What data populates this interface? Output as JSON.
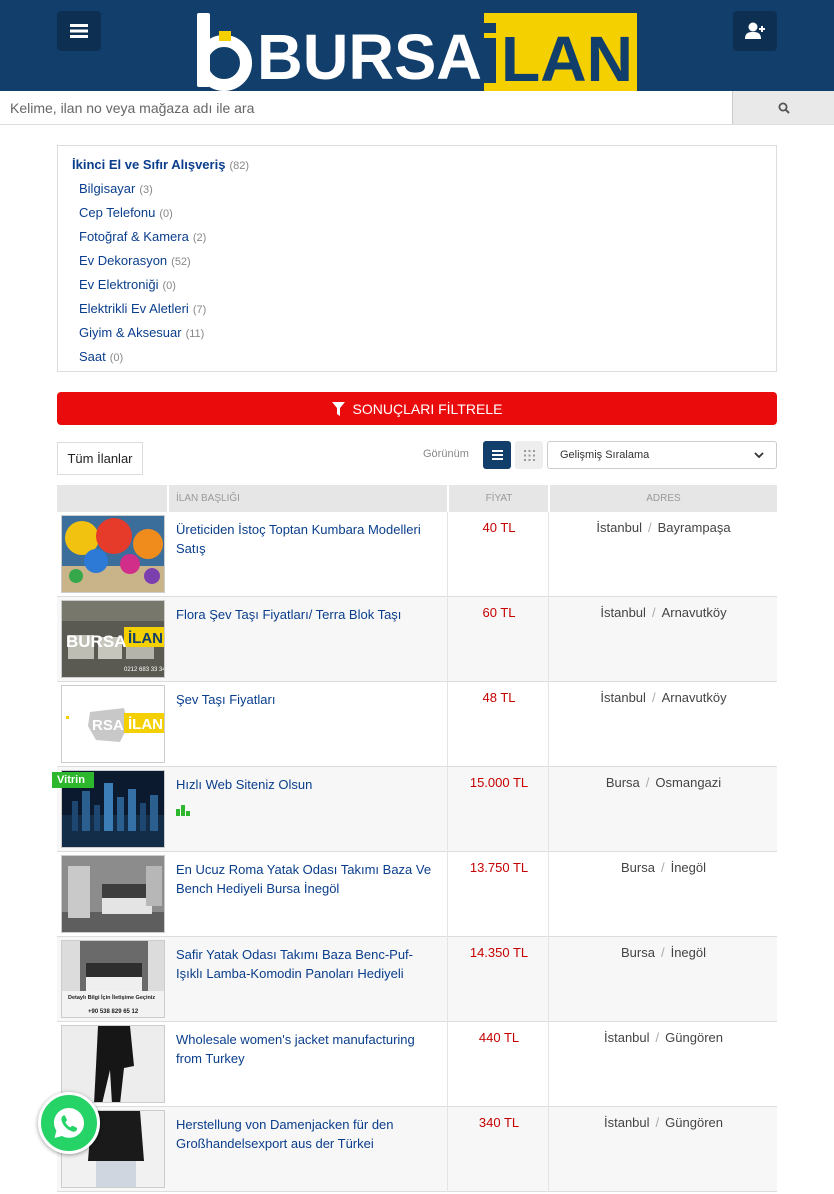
{
  "header": {
    "brand": "BURSA İLAN",
    "brand_colors": {
      "blue": "#123e6b",
      "yellow": "#f5d000",
      "white": "#ffffff"
    }
  },
  "search": {
    "placeholder": "Kelime, ilan no veya mağaza adı ile ara"
  },
  "categories": {
    "main": {
      "label": "İkinci El ve Sıfır Alışveriş",
      "count": "(82)"
    },
    "items": [
      {
        "label": "Bilgisayar",
        "count": "(3)"
      },
      {
        "label": "Cep Telefonu",
        "count": "(0)"
      },
      {
        "label": "Fotoğraf & Kamera",
        "count": "(2)"
      },
      {
        "label": "Ev Dekorasyon",
        "count": "(52)"
      },
      {
        "label": "Ev Elektroniği",
        "count": "(0)"
      },
      {
        "label": "Elektrikli Ev Aletleri",
        "count": "(7)"
      },
      {
        "label": "Giyim & Aksesuar",
        "count": "(11)"
      },
      {
        "label": "Saat",
        "count": "(0)"
      }
    ]
  },
  "filter": {
    "label": "SONUÇLARI FİLTRELE"
  },
  "toolbar": {
    "all_tab": "Tüm İlanlar",
    "view_label": "Görünüm",
    "sort_value": "Gelişmiş Sıralama"
  },
  "table": {
    "headers": {
      "title": "İLAN BAŞLIĞI",
      "price": "FİYAT",
      "address": "ADRES"
    },
    "rows": [
      {
        "title": "Üreticiden İstoç Toptan Kumbara Modelleri Satış",
        "price": "40 TL",
        "city": "İstanbul",
        "district": "Bayrampaşa",
        "badge": ""
      },
      {
        "title": "Flora Şev Taşı Fiyatları/ Terra Blok Taşı",
        "price": "60 TL",
        "city": "İstanbul",
        "district": "Arnavutköy",
        "badge": ""
      },
      {
        "title": "Şev Taşı Fiyatları",
        "price": "48 TL",
        "city": "İstanbul",
        "district": "Arnavutköy",
        "badge": ""
      },
      {
        "title": "Hızlı Web Siteniz Olsun",
        "price": "15.000 TL",
        "city": "Bursa",
        "district": "Osmangazi",
        "badge": "Vitrin"
      },
      {
        "title": "En Ucuz Roma Yatak Odası Takımı Baza Ve Bench Hediyeli Bursa İnegöl",
        "price": "13.750 TL",
        "city": "Bursa",
        "district": "İnegöl",
        "badge": ""
      },
      {
        "title": "Safir Yatak Odası Takımı Baza Benc-Puf-Işıklı Lamba-Komodin Panoları Hediyeli",
        "price": "14.350 TL",
        "city": "Bursa",
        "district": "İnegöl",
        "badge": ""
      },
      {
        "title": "Wholesale women's jacket manufacturing from Turkey",
        "price": "440 TL",
        "city": "İstanbul",
        "district": "Güngören",
        "badge": ""
      },
      {
        "title": "Herstellung von Damenjacken für den Großhandelsexport aus der Türkei",
        "price": "340 TL",
        "city": "İstanbul",
        "district": "Güngören",
        "badge": ""
      }
    ]
  },
  "icons": [
    "menu-icon",
    "user-icon",
    "search-icon",
    "filter-icon",
    "list-view-icon",
    "grid-view-icon",
    "chevron-down-icon",
    "stats-icon",
    "whatsapp-icon"
  ],
  "colors": {
    "accent_red": "#ea0c0c",
    "price_red": "#c60000",
    "link_blue": "#0a3e8c",
    "vitrin_green": "#2cb72c",
    "whatsapp_green": "#25d366"
  }
}
